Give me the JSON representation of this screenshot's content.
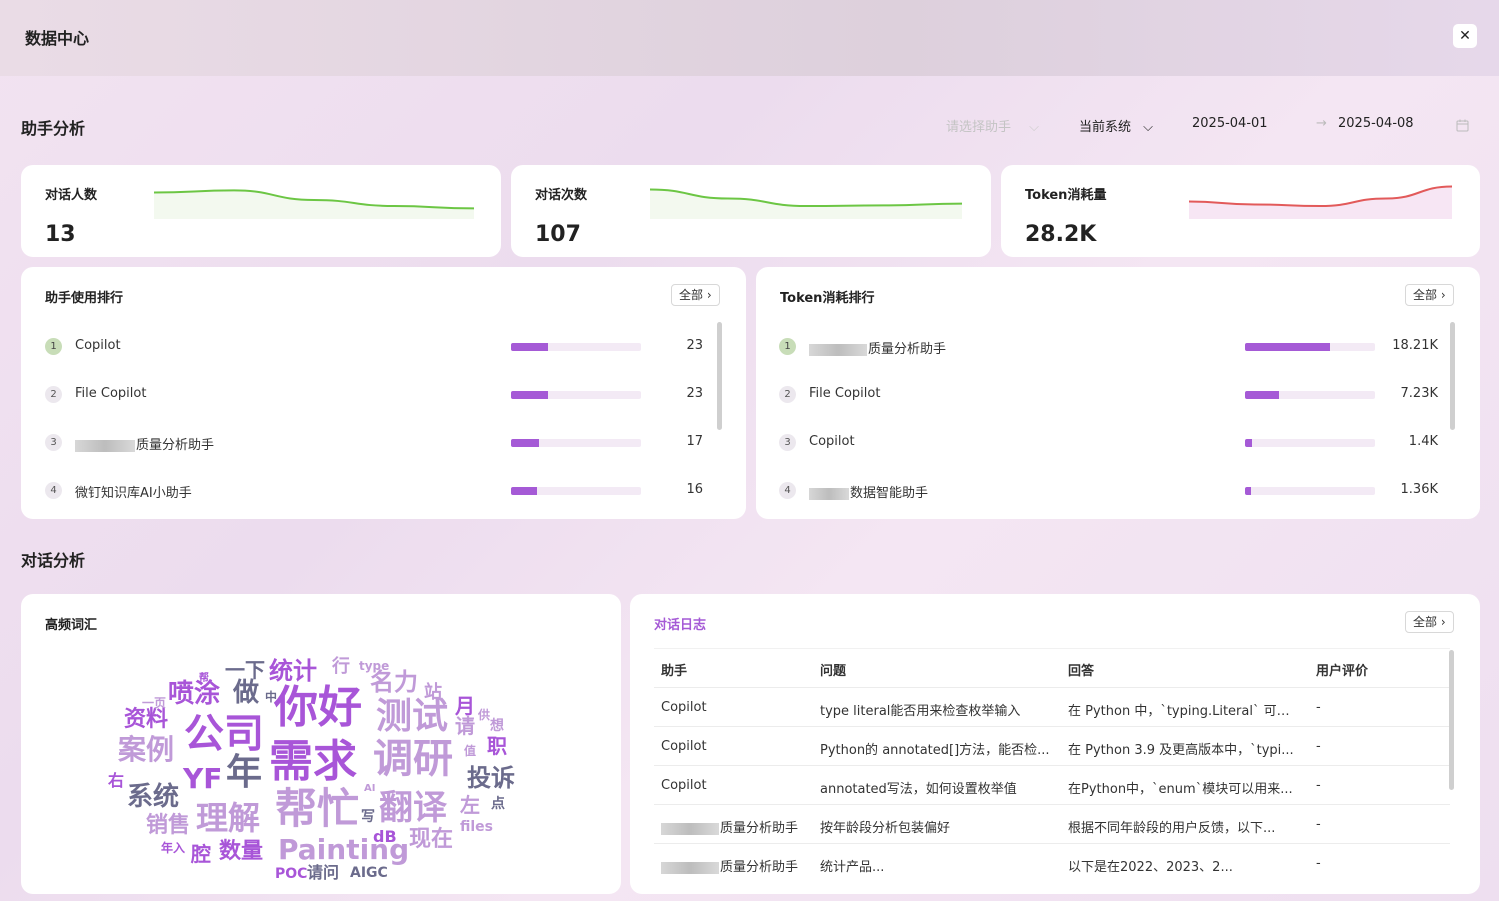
{
  "header": {
    "title": "数据中心",
    "close_label": "✕"
  },
  "assistant_analysis": {
    "title": "助手分析",
    "filters": {
      "assistant_placeholder": "请选择助手",
      "system": "当前系统",
      "date_start": "2025-04-01",
      "date_sep": "→",
      "date_end": "2025-04-08"
    },
    "stats": [
      {
        "label": "对话人数",
        "value": "13",
        "trend": [
          0.75,
          0.82,
          0.5,
          0.3,
          0.22
        ],
        "color": "#6cc644"
      },
      {
        "label": "对话次数",
        "value": "107",
        "trend": [
          0.85,
          0.55,
          0.3,
          0.32,
          0.38
        ],
        "color": "#6cc644"
      },
      {
        "label": "Token消耗量",
        "value": "28.2K",
        "trend": [
          0.45,
          0.35,
          0.3,
          0.55,
          0.95
        ],
        "color": "#e25a5a"
      }
    ],
    "usage_ranking": {
      "title": "助手使用排行",
      "all_label": "全部",
      "max": 80,
      "items": [
        {
          "rank": "1",
          "name": "Copilot",
          "value": 23,
          "value_label": "23"
        },
        {
          "rank": "2",
          "name": "File Copilot",
          "value": 23,
          "value_label": "23"
        },
        {
          "rank": "3",
          "name": "质量分析助手",
          "value": 17,
          "value_label": "17"
        },
        {
          "rank": "4",
          "name": "微钉知识库AI小助手",
          "value": 16,
          "value_label": "16"
        }
      ]
    },
    "token_ranking": {
      "title": "Token消耗排行",
      "all_label": "全部",
      "max": 28,
      "items": [
        {
          "rank": "1",
          "name": "质量分析助手",
          "value": 18.21,
          "value_label": "18.21K"
        },
        {
          "rank": "2",
          "name": "File Copilot",
          "value": 7.23,
          "value_label": "7.23K"
        },
        {
          "rank": "3",
          "name": "Copilot",
          "value": 1.4,
          "value_label": "1.4K"
        },
        {
          "rank": "4",
          "name": "数据智能助手",
          "value": 1.36,
          "value_label": "1.36K"
        }
      ]
    }
  },
  "conversation_analysis": {
    "title": "对话分析",
    "word_cloud": {
      "title": "高频词汇",
      "words": [
        "你好",
        "需求",
        "公司",
        "帮忙",
        "调研",
        "测试",
        "年",
        "翻译",
        "理解",
        "统计",
        "名力",
        "喷涂",
        "做",
        "案例",
        "系统",
        "资料",
        "投诉",
        "销售",
        "数量",
        "Painting",
        "现在",
        "YF",
        "站",
        "请",
        "职",
        "左",
        "月",
        "一下",
        "行",
        "type",
        "一页",
        "中",
        "想",
        "供",
        "值",
        "右",
        "点",
        "files",
        "写",
        "dB",
        "AI",
        "年入",
        "腔",
        "POC",
        "请问",
        "AIGC",
        "帮"
      ]
    },
    "log": {
      "title": "对话日志",
      "all_label": "全部",
      "columns": [
        "助手",
        "问题",
        "回答",
        "用户评价"
      ],
      "rows": [
        {
          "assistant": "Copilot",
          "question": "type literal能否用来检查枚举输入",
          "answer": "在 Python 中，`typing.Literal` 可以...",
          "rating": "-"
        },
        {
          "assistant": "Copilot",
          "question": "Python的 annotated[]方法，能否检...",
          "answer": "在 Python 3.9 及更高版本中，`typi...",
          "rating": "-"
        },
        {
          "assistant": "Copilot",
          "question": "annotated写法，如何设置枚举值",
          "answer": "在Python中，`enum`模块可以用来...",
          "rating": "-"
        },
        {
          "assistant": "质量分析助手",
          "question": "按年龄段分析包装偏好",
          "answer": "根据不同年龄段的用户反馈，以下...",
          "rating": "-"
        },
        {
          "assistant": "质量分析助手",
          "question": "统计产品...",
          "answer": "以下是在2022、2023、2...",
          "rating": "-"
        }
      ]
    }
  }
}
